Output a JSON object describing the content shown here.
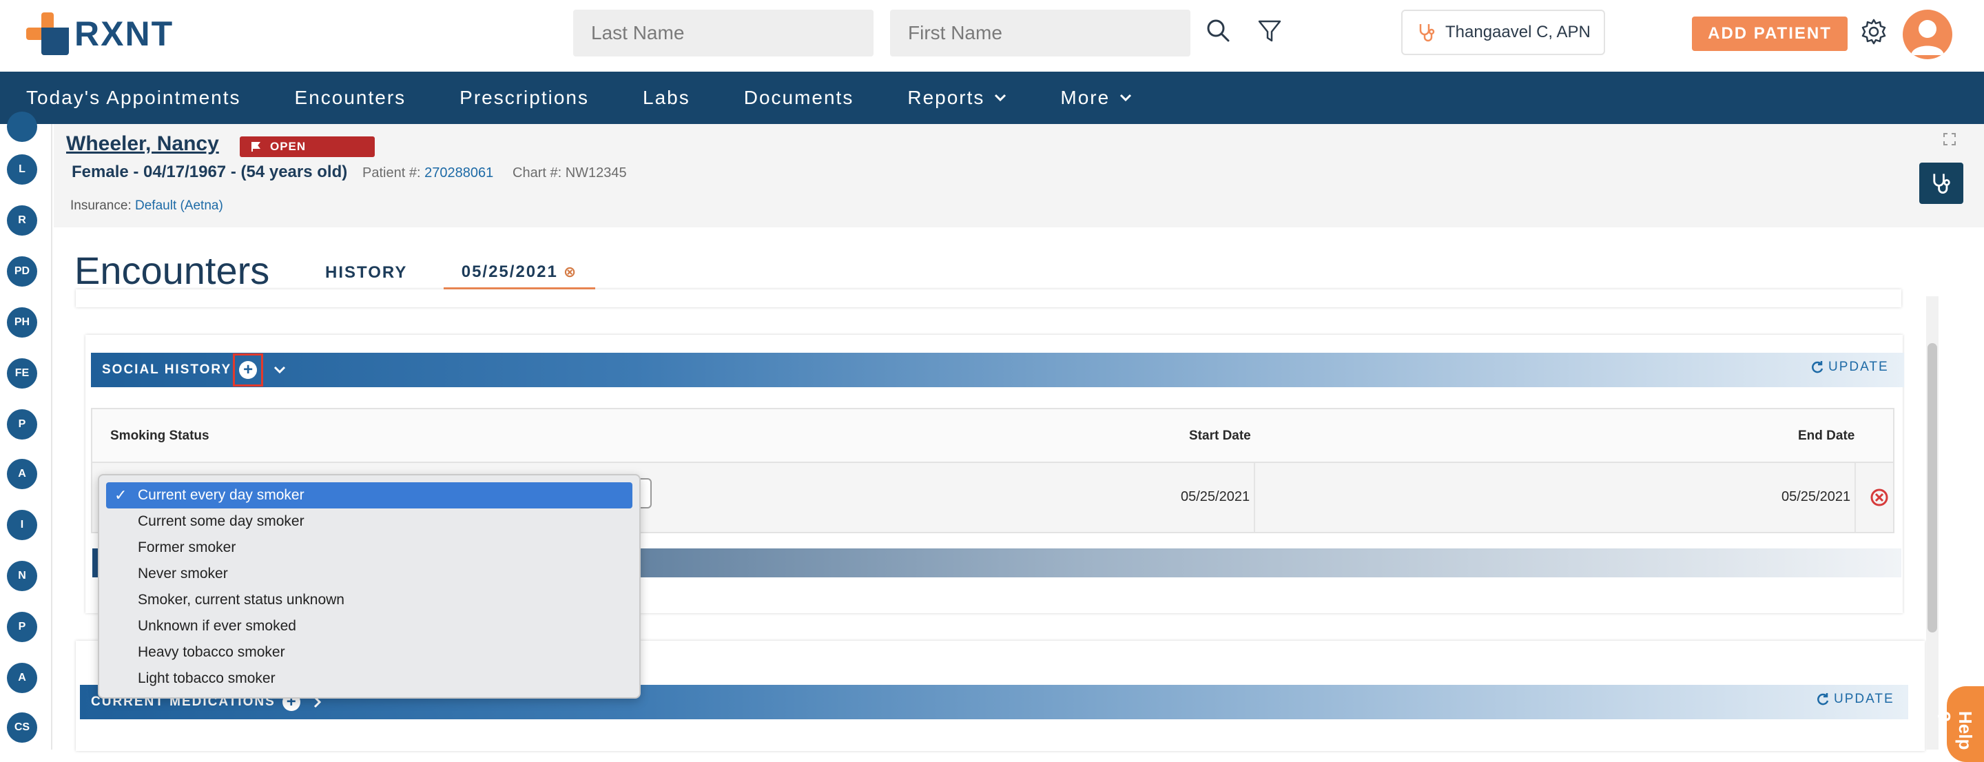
{
  "header": {
    "logo_text": "RXNT",
    "last_name_placeholder": "Last Name",
    "first_name_placeholder": "First Name",
    "provider_name": "Thangaavel C, APN",
    "add_patient_label": "ADD PATIENT"
  },
  "nav": {
    "items": [
      {
        "label": "Today's Appointments"
      },
      {
        "label": "Encounters"
      },
      {
        "label": "Prescriptions"
      },
      {
        "label": "Labs"
      },
      {
        "label": "Documents"
      },
      {
        "label": "Reports",
        "has_dropdown": true
      },
      {
        "label": "More",
        "has_dropdown": true
      }
    ]
  },
  "rail": {
    "items": [
      "L",
      "R",
      "PD",
      "PH",
      "FE",
      "P",
      "A",
      "I",
      "N",
      "P",
      "A",
      "CS"
    ]
  },
  "patient": {
    "name": "Wheeler, Nancy",
    "status_badge": "OPEN",
    "demographics": "Female - 04/17/1967 - (54 years old)",
    "patient_no_label": "Patient #:",
    "patient_no": "270288061",
    "chart_no_label": "Chart #:",
    "chart_no": "NW12345",
    "insurance_label": "Insurance:",
    "insurance_value": "Default (Aetna)"
  },
  "encounters": {
    "title": "Encounters",
    "tab_history": "HISTORY",
    "tab_date": "05/25/2021"
  },
  "social_history": {
    "section_label": "SOCIAL HISTORY",
    "update_label": "UPDATE",
    "columns": [
      "Smoking Status",
      "Start Date",
      "End Date"
    ],
    "row": {
      "start_date": "05/25/2021",
      "end_date": "05/25/2021"
    },
    "smoking_options": [
      "Current every day smoker",
      "Current some day smoker",
      "Former smoker",
      "Never smoker",
      "Smoker, current status unknown",
      "Unknown if ever smoked",
      "Heavy tobacco smoker",
      "Light tobacco smoker"
    ],
    "selected_option": "Current every day smoker"
  },
  "current_medications": {
    "section_label": "CURRENT MEDICATIONS",
    "update_label": "UPDATE"
  },
  "help": {
    "label": "Help ?"
  },
  "colors": {
    "brand_navy": "#17456b",
    "brand_orange": "#f28b56",
    "badge_red": "#b72a2a",
    "select_blue": "#3a7bd5"
  }
}
